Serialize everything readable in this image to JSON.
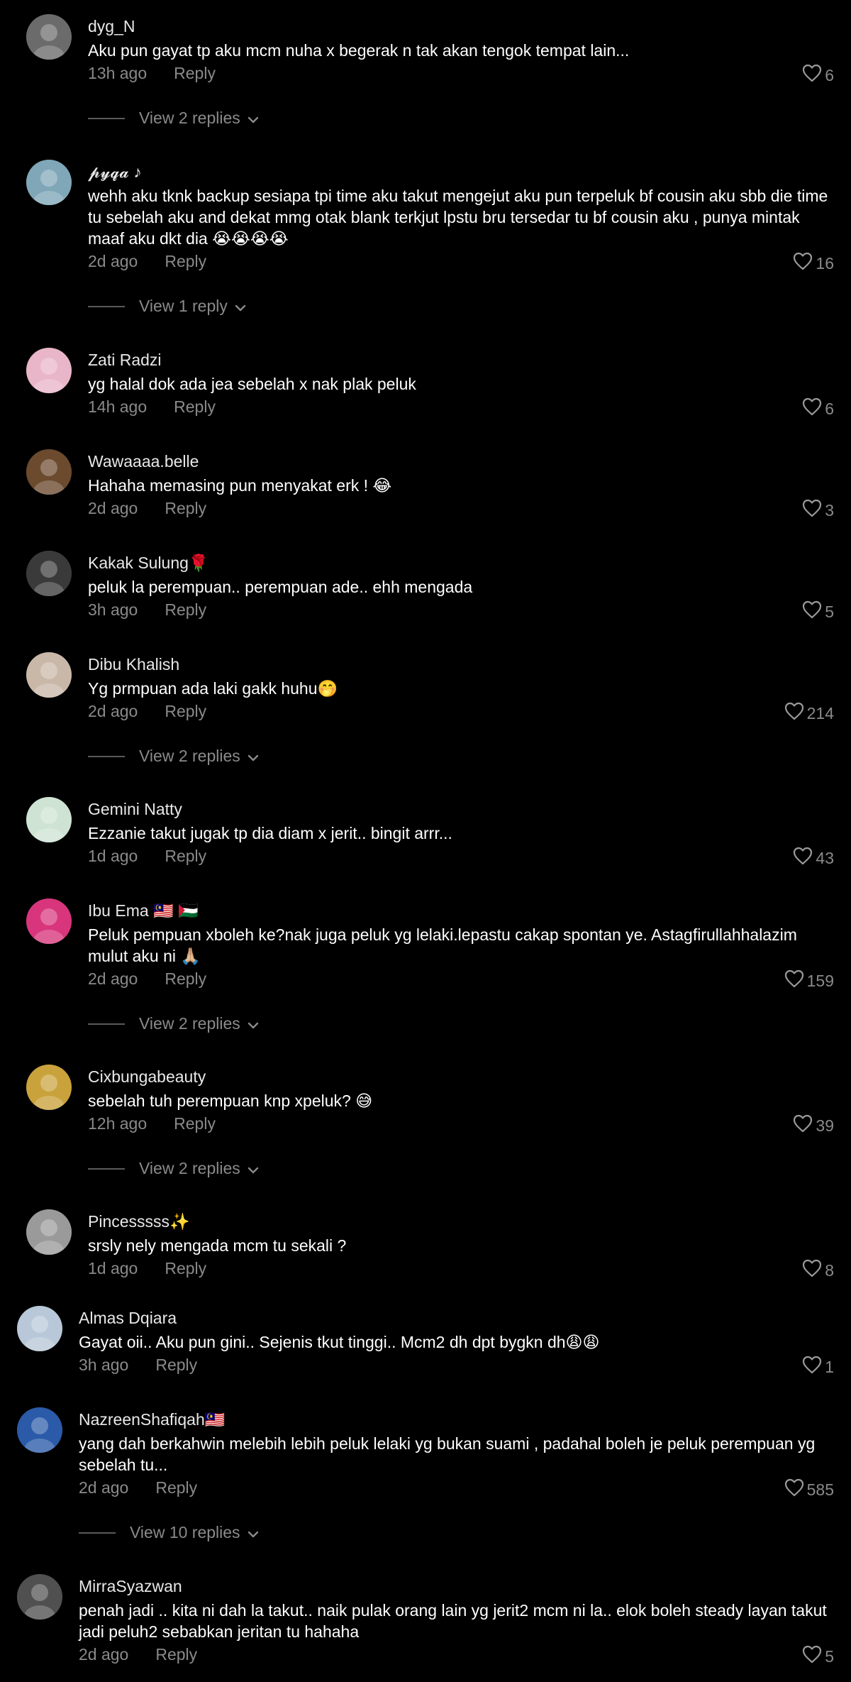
{
  "comments": [
    {
      "user": "dyg_N",
      "text": "Aku pun gayat tp aku mcm nuha x begerak n tak akan tengok tempat lain...",
      "time": "13h ago",
      "reply": "Reply",
      "likes": "6",
      "view_replies": "View 2 replies",
      "avatar_color": "#6b6b6b"
    },
    {
      "user": "𝓹𝔂𝓺𝓪 ♪",
      "text": "wehh aku tknk backup sesiapa tpi time aku takut mengejut aku pun terpeluk bf cousin aku sbb die time tu sebelah aku and dekat mmg otak blank terkjut lpstu bru tersedar tu bf cousin aku , punya mintak maaf aku dkt dia 😭😭😭😭",
      "time": "2d ago",
      "reply": "Reply",
      "likes": "16",
      "view_replies": "View 1 reply",
      "avatar_color": "#7fa7b8"
    },
    {
      "user": "Zati Radzi",
      "text": "yg halal dok ada jea sebelah x nak plak peluk",
      "time": "14h ago",
      "reply": "Reply",
      "likes": "6",
      "view_replies": "",
      "avatar_color": "#e9b5c8"
    },
    {
      "user": "Wawaaaa.belle",
      "text": "Hahaha memasing pun menyakat erk ! 😂",
      "time": "2d ago",
      "reply": "Reply",
      "likes": "3",
      "view_replies": "",
      "avatar_color": "#6b4a2e"
    },
    {
      "user": "Kakak Sulung🌹",
      "text": "peluk la perempuan.. perempuan ade.. ehh mengada",
      "time": "3h ago",
      "reply": "Reply",
      "likes": "5",
      "view_replies": "",
      "avatar_color": "#3a3a3a"
    },
    {
      "user": "Dibu Khalish",
      "text": "Yg prmpuan ada laki gakk huhu🤭",
      "time": "2d ago",
      "reply": "Reply",
      "likes": "214",
      "view_replies": "View 2 replies",
      "avatar_color": "#c9b8a8"
    },
    {
      "user": "Gemini Natty",
      "text": "Ezzanie takut jugak tp dia diam x jerit.. bingit arrr...",
      "time": "1d ago",
      "reply": "Reply",
      "likes": "43",
      "view_replies": "",
      "avatar_color": "#cfe3d4"
    },
    {
      "user": "Ibu Ema 🇲🇾 🇵🇸",
      "text": "Peluk pempuan xboleh ke?nak juga peluk yg lelaki.lepastu cakap spontan ye. Astagfirullahhalazim mulut aku ni 🙏🏼",
      "time": "2d ago",
      "reply": "Reply",
      "likes": "159",
      "view_replies": "View 2 replies",
      "avatar_color": "#d8357c"
    },
    {
      "user": "Cixbungabeauty",
      "text": "sebelah tuh perempuan knp xpeluk? 😅",
      "time": "12h ago",
      "reply": "Reply",
      "likes": "39",
      "view_replies": "View 2 replies",
      "avatar_color": "#c9a23c"
    },
    {
      "user": "Pincesssss✨",
      "text": "srsly nely mengada mcm tu sekali ?",
      "time": "1d ago",
      "reply": "Reply",
      "likes": "8",
      "view_replies": "",
      "avatar_color": "#9a9a9a"
    },
    {
      "user": "Almas Dqiara",
      "text": "Gayat oii.. Aku pun gini.. Sejenis tkut tinggi.. Mcm2 dh dpt bygkn dh😩😩",
      "time": "3h ago",
      "reply": "Reply",
      "likes": "1",
      "view_replies": "",
      "avatar_color": "#b8c8d8"
    },
    {
      "user": "NazreenShafiqah🇲🇾",
      "text": "yang dah berkahwin melebih lebih peluk lelaki yg bukan suami , padahal boleh je peluk perempuan yg sebelah tu...",
      "time": "2d ago",
      "reply": "Reply",
      "likes": "585",
      "view_replies": "View 10 replies",
      "avatar_color": "#2a5aa8"
    },
    {
      "user": "MirraSyazwan",
      "text": "penah jadi .. kita ni dah la takut.. naik pulak orang lain yg jerit2 mcm ni la.. elok boleh steady layan takut jadi peluh2 sebabkan jeritan tu hahaha",
      "time": "2d ago",
      "reply": "Reply",
      "likes": "5",
      "view_replies": "",
      "avatar_color": "#505050"
    }
  ],
  "icons": {
    "like": "heart-outline-icon",
    "chevron": "chevron-down-icon"
  }
}
